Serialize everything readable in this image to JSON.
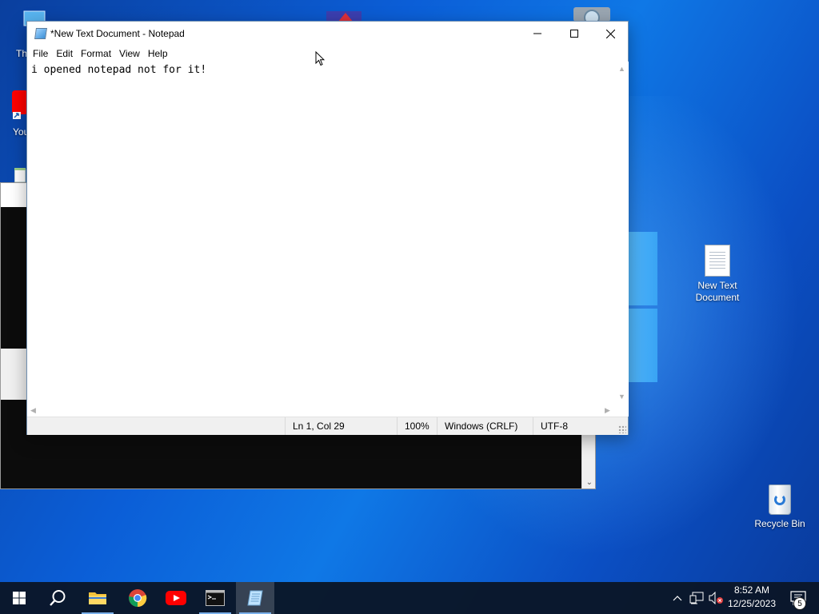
{
  "desktop": {
    "icons": [
      {
        "label": "New Text Document",
        "icon": "text-document-icon"
      },
      {
        "label": "Recycle Bin",
        "icon": "recycle-bin-icon"
      }
    ],
    "partial_labels": {
      "this_pc": "Th",
      "youtube": "You"
    }
  },
  "notepad": {
    "title": "*New Text Document - Notepad",
    "menu": [
      "File",
      "Edit",
      "Format",
      "View",
      "Help"
    ],
    "content": "i opened notepad not for it!",
    "status": {
      "position": "Ln 1, Col 29",
      "zoom": "100%",
      "line_ending": "Windows (CRLF)",
      "encoding": "UTF-8"
    },
    "caption_buttons": [
      "minimize-icon",
      "maximize-icon",
      "close-icon"
    ]
  },
  "taskbar": {
    "apps": [
      {
        "name": "start",
        "icon": "windows-logo-icon"
      },
      {
        "name": "search",
        "icon": "search-icon"
      },
      {
        "name": "file-explorer",
        "icon": "folder-icon"
      },
      {
        "name": "chrome",
        "icon": "chrome-icon"
      },
      {
        "name": "youtube",
        "icon": "youtube-icon"
      },
      {
        "name": "terminal",
        "icon": "terminal-icon"
      },
      {
        "name": "notepad",
        "icon": "notepad-icon"
      }
    ],
    "clock": {
      "time": "8:52 AM",
      "date": "12/25/2023"
    },
    "notifications_count": "5"
  },
  "colors": {
    "taskbar": "#0a1628",
    "desktop_blue": "#0b5ed7",
    "accent_underline": "#7ab0ea"
  }
}
